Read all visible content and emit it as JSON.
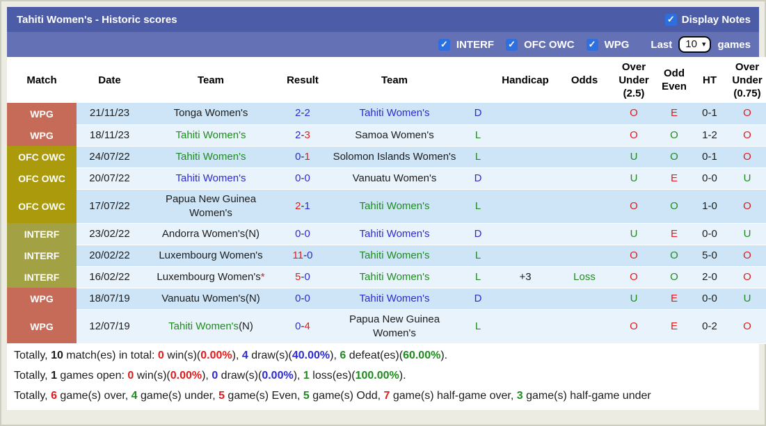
{
  "colors": {
    "red": "#e11b1b",
    "blue": "#2b2bcf",
    "green": "#1f8b1f",
    "black": "#1c1c1c",
    "title_bar_bg": "#4d5ca7",
    "filter_bar_bg": "#6571b5",
    "row_odd_bg": "#cde5f6",
    "row_even_bg": "#e9f3fb",
    "checkbox_blue": "#2e6fe0",
    "league_wpg": "#c76b59",
    "league_ofc_owc": "#ab9a0b",
    "league_interf": "#a2a244"
  },
  "icons": {
    "check": "✓",
    "chevron_down": "▾"
  },
  "header": {
    "title": "Tahiti Women's - Historic scores",
    "display_notes_label": "Display Notes",
    "display_notes_checked": true
  },
  "filter_bar": {
    "checkboxes": [
      {
        "label": "INTERF",
        "checked": true
      },
      {
        "label": "OFC OWC",
        "checked": true
      },
      {
        "label": "WPG",
        "checked": true
      }
    ],
    "last_label": "Last",
    "games_count": "10",
    "games_label": "games"
  },
  "table": {
    "columns": [
      "Match",
      "Date",
      "Team",
      "Result",
      "Team",
      "",
      "Handicap",
      "Odds",
      "Over Under (2.5)",
      "Odd Even",
      "HT",
      "Over Under (0.75)"
    ],
    "rows": [
      {
        "league": "WPG",
        "league_color": "league_wpg",
        "date": "21/11/23",
        "home": {
          "name": "Tonga Women's",
          "color": "black",
          "mark": "",
          "mark_color": "black"
        },
        "score": {
          "home": "2",
          "home_color": "blue",
          "away": "2",
          "away_color": "blue"
        },
        "away": {
          "name": "Tahiti Women's",
          "color": "blue",
          "mark": "",
          "mark_color": "black"
        },
        "outcome": {
          "text": "D",
          "color": "blue"
        },
        "handicap": "",
        "odds": {
          "text": "",
          "color": "green"
        },
        "ou25": {
          "text": "O",
          "color": "red"
        },
        "oddeven": {
          "text": "E",
          "color": "red"
        },
        "ht": "0-1",
        "ou075": {
          "text": "O",
          "color": "red"
        }
      },
      {
        "league": "WPG",
        "league_color": "league_wpg",
        "date": "18/11/23",
        "home": {
          "name": "Tahiti Women's",
          "color": "green",
          "mark": "",
          "mark_color": "black"
        },
        "score": {
          "home": "2",
          "home_color": "blue",
          "away": "3",
          "away_color": "red"
        },
        "away": {
          "name": "Samoa Women's",
          "color": "black",
          "mark": "",
          "mark_color": "black"
        },
        "outcome": {
          "text": "L",
          "color": "green"
        },
        "handicap": "",
        "odds": {
          "text": "",
          "color": "green"
        },
        "ou25": {
          "text": "O",
          "color": "red"
        },
        "oddeven": {
          "text": "O",
          "color": "green"
        },
        "ht": "1-2",
        "ou075": {
          "text": "O",
          "color": "red"
        }
      },
      {
        "league": "OFC OWC",
        "league_color": "league_ofc_owc",
        "date": "24/07/22",
        "home": {
          "name": "Tahiti Women's",
          "color": "green",
          "mark": "",
          "mark_color": "black"
        },
        "score": {
          "home": "0",
          "home_color": "blue",
          "away": "1",
          "away_color": "red"
        },
        "away": {
          "name": "Solomon Islands Women's",
          "color": "black",
          "mark": "",
          "mark_color": "black"
        },
        "outcome": {
          "text": "L",
          "color": "green"
        },
        "handicap": "",
        "odds": {
          "text": "",
          "color": "green"
        },
        "ou25": {
          "text": "U",
          "color": "green"
        },
        "oddeven": {
          "text": "O",
          "color": "green"
        },
        "ht": "0-1",
        "ou075": {
          "text": "O",
          "color": "red"
        }
      },
      {
        "league": "OFC OWC",
        "league_color": "league_ofc_owc",
        "date": "20/07/22",
        "home": {
          "name": "Tahiti Women's",
          "color": "blue",
          "mark": "",
          "mark_color": "black"
        },
        "score": {
          "home": "0",
          "home_color": "blue",
          "away": "0",
          "away_color": "blue"
        },
        "away": {
          "name": "Vanuatu Women's",
          "color": "black",
          "mark": "",
          "mark_color": "black"
        },
        "outcome": {
          "text": "D",
          "color": "blue"
        },
        "handicap": "",
        "odds": {
          "text": "",
          "color": "green"
        },
        "ou25": {
          "text": "U",
          "color": "green"
        },
        "oddeven": {
          "text": "E",
          "color": "red"
        },
        "ht": "0-0",
        "ou075": {
          "text": "U",
          "color": "green"
        }
      },
      {
        "league": "OFC OWC",
        "league_color": "league_ofc_owc",
        "date": "17/07/22",
        "home": {
          "name": "Papua New Guinea Women's",
          "color": "black",
          "mark": "",
          "mark_color": "black"
        },
        "score": {
          "home": "2",
          "home_color": "red",
          "away": "1",
          "away_color": "blue"
        },
        "away": {
          "name": "Tahiti Women's",
          "color": "green",
          "mark": "",
          "mark_color": "black"
        },
        "outcome": {
          "text": "L",
          "color": "green"
        },
        "handicap": "",
        "odds": {
          "text": "",
          "color": "green"
        },
        "ou25": {
          "text": "O",
          "color": "red"
        },
        "oddeven": {
          "text": "O",
          "color": "green"
        },
        "ht": "1-0",
        "ou075": {
          "text": "O",
          "color": "red"
        }
      },
      {
        "league": "INTERF",
        "league_color": "league_interf",
        "date": "23/02/22",
        "home": {
          "name": "Andorra Women's(N)",
          "color": "black",
          "mark": "",
          "mark_color": "black"
        },
        "score": {
          "home": "0",
          "home_color": "blue",
          "away": "0",
          "away_color": "blue"
        },
        "away": {
          "name": "Tahiti Women's",
          "color": "blue",
          "mark": "",
          "mark_color": "black"
        },
        "outcome": {
          "text": "D",
          "color": "blue"
        },
        "handicap": "",
        "odds": {
          "text": "",
          "color": "green"
        },
        "ou25": {
          "text": "U",
          "color": "green"
        },
        "oddeven": {
          "text": "E",
          "color": "red"
        },
        "ht": "0-0",
        "ou075": {
          "text": "U",
          "color": "green"
        }
      },
      {
        "league": "INTERF",
        "league_color": "league_interf",
        "date": "20/02/22",
        "home": {
          "name": "Luxembourg Women's",
          "color": "black",
          "mark": "",
          "mark_color": "black"
        },
        "score": {
          "home": "11",
          "home_color": "red",
          "away": "0",
          "away_color": "blue"
        },
        "away": {
          "name": "Tahiti Women's",
          "color": "green",
          "mark": "",
          "mark_color": "black"
        },
        "outcome": {
          "text": "L",
          "color": "green"
        },
        "handicap": "",
        "odds": {
          "text": "",
          "color": "green"
        },
        "ou25": {
          "text": "O",
          "color": "red"
        },
        "oddeven": {
          "text": "O",
          "color": "green"
        },
        "ht": "5-0",
        "ou075": {
          "text": "O",
          "color": "red"
        }
      },
      {
        "league": "INTERF",
        "league_color": "league_interf",
        "date": "16/02/22",
        "home": {
          "name": "Luxembourg Women's",
          "color": "black",
          "mark": "*",
          "mark_color": "red"
        },
        "score": {
          "home": "5",
          "home_color": "red",
          "away": "0",
          "away_color": "blue"
        },
        "away": {
          "name": "Tahiti Women's",
          "color": "green",
          "mark": "",
          "mark_color": "black"
        },
        "outcome": {
          "text": "L",
          "color": "green"
        },
        "handicap": "+3",
        "odds": {
          "text": "Loss",
          "color": "green"
        },
        "ou25": {
          "text": "O",
          "color": "red"
        },
        "oddeven": {
          "text": "O",
          "color": "green"
        },
        "ht": "2-0",
        "ou075": {
          "text": "O",
          "color": "red"
        }
      },
      {
        "league": "WPG",
        "league_color": "league_wpg",
        "date": "18/07/19",
        "home": {
          "name": "Vanuatu Women's(N)",
          "color": "black",
          "mark": "",
          "mark_color": "black"
        },
        "score": {
          "home": "0",
          "home_color": "blue",
          "away": "0",
          "away_color": "blue"
        },
        "away": {
          "name": "Tahiti Women's",
          "color": "blue",
          "mark": "",
          "mark_color": "black"
        },
        "outcome": {
          "text": "D",
          "color": "blue"
        },
        "handicap": "",
        "odds": {
          "text": "",
          "color": "green"
        },
        "ou25": {
          "text": "U",
          "color": "green"
        },
        "oddeven": {
          "text": "E",
          "color": "red"
        },
        "ht": "0-0",
        "ou075": {
          "text": "U",
          "color": "green"
        }
      },
      {
        "league": "WPG",
        "league_color": "league_wpg",
        "date": "12/07/19",
        "home": {
          "name": "Tahiti Women's",
          "color": "green",
          "mark": "(N)",
          "mark_color": "black"
        },
        "score": {
          "home": "0",
          "home_color": "blue",
          "away": "4",
          "away_color": "red"
        },
        "away": {
          "name": "Papua New Guinea Women's",
          "color": "black",
          "mark": "",
          "mark_color": "black"
        },
        "outcome": {
          "text": "L",
          "color": "green"
        },
        "handicap": "",
        "odds": {
          "text": "",
          "color": "green"
        },
        "ou25": {
          "text": "O",
          "color": "red"
        },
        "oddeven": {
          "text": "E",
          "color": "red"
        },
        "ht": "0-2",
        "ou075": {
          "text": "O",
          "color": "red"
        }
      }
    ]
  },
  "footer_lines": [
    [
      {
        "t": "Totally, ",
        "c": "black",
        "b": false
      },
      {
        "t": "10",
        "c": "black",
        "b": true
      },
      {
        "t": " match(es) in total: ",
        "c": "black",
        "b": false
      },
      {
        "t": "0",
        "c": "red",
        "b": true
      },
      {
        "t": " win(s)(",
        "c": "black",
        "b": false
      },
      {
        "t": "0.00%",
        "c": "red",
        "b": true
      },
      {
        "t": "), ",
        "c": "black",
        "b": false
      },
      {
        "t": "4",
        "c": "blue",
        "b": true
      },
      {
        "t": " draw(s)(",
        "c": "black",
        "b": false
      },
      {
        "t": "40.00%",
        "c": "blue",
        "b": true
      },
      {
        "t": "), ",
        "c": "black",
        "b": false
      },
      {
        "t": "6",
        "c": "green",
        "b": true
      },
      {
        "t": " defeat(es)(",
        "c": "black",
        "b": false
      },
      {
        "t": "60.00%",
        "c": "green",
        "b": true
      },
      {
        "t": ").",
        "c": "black",
        "b": false
      }
    ],
    [
      {
        "t": "Totally, ",
        "c": "black",
        "b": false
      },
      {
        "t": "1",
        "c": "black",
        "b": true
      },
      {
        "t": " games open: ",
        "c": "black",
        "b": false
      },
      {
        "t": "0",
        "c": "red",
        "b": true
      },
      {
        "t": " win(s)(",
        "c": "black",
        "b": false
      },
      {
        "t": "0.00%",
        "c": "red",
        "b": true
      },
      {
        "t": "), ",
        "c": "black",
        "b": false
      },
      {
        "t": "0",
        "c": "blue",
        "b": true
      },
      {
        "t": " draw(s)(",
        "c": "black",
        "b": false
      },
      {
        "t": "0.00%",
        "c": "blue",
        "b": true
      },
      {
        "t": "), ",
        "c": "black",
        "b": false
      },
      {
        "t": "1",
        "c": "green",
        "b": true
      },
      {
        "t": " loss(es)(",
        "c": "black",
        "b": false
      },
      {
        "t": "100.00%",
        "c": "green",
        "b": true
      },
      {
        "t": ").",
        "c": "black",
        "b": false
      }
    ],
    [
      {
        "t": "Totally, ",
        "c": "black",
        "b": false
      },
      {
        "t": "6",
        "c": "red",
        "b": true
      },
      {
        "t": " game(s) over, ",
        "c": "black",
        "b": false
      },
      {
        "t": "4",
        "c": "green",
        "b": true
      },
      {
        "t": " game(s) under, ",
        "c": "black",
        "b": false
      },
      {
        "t": "5",
        "c": "red",
        "b": true
      },
      {
        "t": " game(s) Even, ",
        "c": "black",
        "b": false
      },
      {
        "t": "5",
        "c": "green",
        "b": true
      },
      {
        "t": " game(s) Odd, ",
        "c": "black",
        "b": false
      },
      {
        "t": "7",
        "c": "red",
        "b": true
      },
      {
        "t": " game(s) half-game over, ",
        "c": "black",
        "b": false
      },
      {
        "t": "3",
        "c": "green",
        "b": true
      },
      {
        "t": " game(s) half-game under",
        "c": "black",
        "b": false
      }
    ]
  ]
}
